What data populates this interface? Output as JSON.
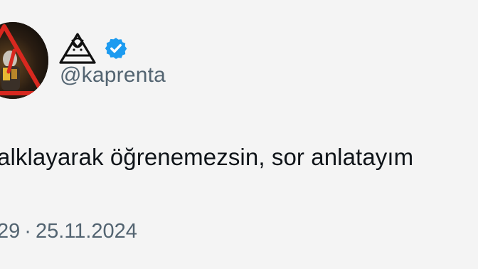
{
  "tweet": {
    "author": {
      "display_name_logo": "triangle-monogram-logo",
      "verified": true,
      "handle": "@kaprenta",
      "avatar": "avatar-warning-triangle-image"
    },
    "text": "alklayarak öğrenemezsin, sor anlatayım",
    "time_partial": "29",
    "separator": "·",
    "date": "25.11.2024"
  },
  "colors": {
    "background": "#f4f4f4",
    "text": "#0f1419",
    "secondary_text": "#536471",
    "verified_badge": "#1d9bf0",
    "avatar_accent": "#d8281f"
  }
}
